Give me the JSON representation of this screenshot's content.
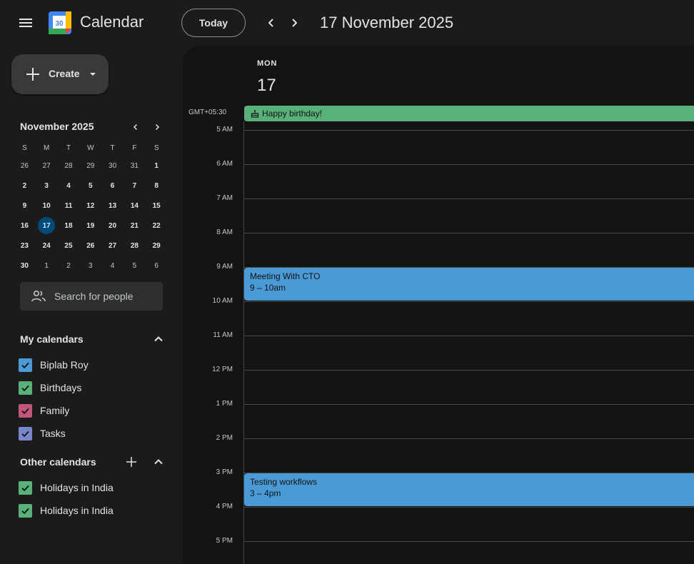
{
  "header": {
    "app_title": "Calendar",
    "logo_day": "30",
    "today_label": "Today",
    "date_title": "17 November 2025"
  },
  "sidebar": {
    "create_label": "Create",
    "mini_calendar": {
      "month_label": "November 2025",
      "weekdays": [
        "S",
        "M",
        "T",
        "W",
        "T",
        "F",
        "S"
      ],
      "weeks": [
        [
          "26",
          "27",
          "28",
          "29",
          "30",
          "31",
          "1"
        ],
        [
          "2",
          "3",
          "4",
          "5",
          "6",
          "7",
          "8"
        ],
        [
          "9",
          "10",
          "11",
          "12",
          "13",
          "14",
          "15"
        ],
        [
          "16",
          "17",
          "18",
          "19",
          "20",
          "21",
          "22"
        ],
        [
          "23",
          "24",
          "25",
          "26",
          "27",
          "28",
          "29"
        ],
        [
          "30",
          "1",
          "2",
          "3",
          "4",
          "5",
          "6"
        ]
      ],
      "today": "17"
    },
    "search_people_placeholder": "Search for people",
    "my_calendars": {
      "title": "My calendars",
      "items": [
        {
          "label": "Biplab Roy",
          "color": "#4a9ad6"
        },
        {
          "label": "Birthdays",
          "color": "#57b178"
        },
        {
          "label": "Family",
          "color": "#c2557a"
        },
        {
          "label": "Tasks",
          "color": "#7986cb"
        }
      ]
    },
    "other_calendars": {
      "title": "Other calendars",
      "items": [
        {
          "label": "Holidays in India",
          "color": "#57b178"
        },
        {
          "label": "Holidays in India",
          "color": "#57b178"
        }
      ]
    }
  },
  "day_view": {
    "weekday": "MON",
    "day_number": "17",
    "timezone": "GMT+05:30",
    "all_day_event": {
      "title": "Happy birthday!",
      "color": "#57b178"
    },
    "hours": [
      "5 AM",
      "6 AM",
      "7 AM",
      "8 AM",
      "9 AM",
      "10 AM",
      "11 AM",
      "12 PM",
      "1 PM",
      "2 PM",
      "3 PM",
      "4 PM",
      "5 PM"
    ],
    "events": [
      {
        "title": "Meeting With CTO",
        "time": "9 – 10am",
        "color": "#4a9ad6"
      },
      {
        "title": "Testing workflows",
        "time": "3 – 4pm",
        "color": "#4a9ad6"
      }
    ]
  }
}
